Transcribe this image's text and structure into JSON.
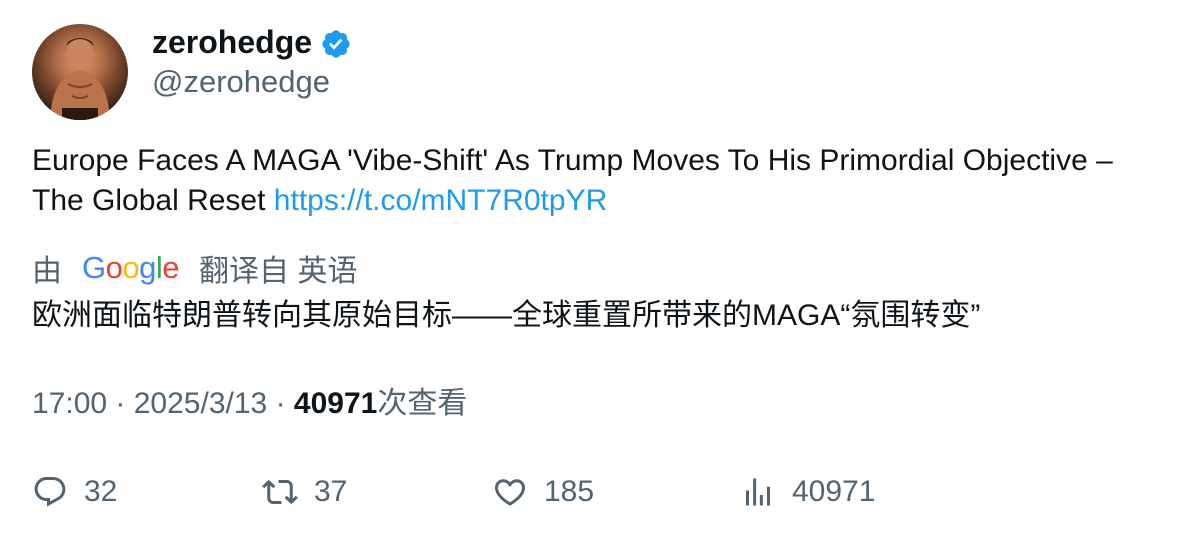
{
  "author": {
    "display_name": "zerohedge",
    "handle": "@zerohedge",
    "verified": true,
    "avatar_icon": "avatar-photo"
  },
  "tweet": {
    "text": "Europe Faces A MAGA 'Vibe-Shift' As Trump Moves To His Primordial Objective – The Global Reset ",
    "link": "https://t.co/mNT7R0tpYR"
  },
  "translation": {
    "prefix": "由",
    "provider_letters": [
      "G",
      "o",
      "o",
      "g",
      "l",
      "e"
    ],
    "suffix": "翻译自 英语",
    "text": "欧洲面临特朗普转向其原始目标——全球重置所带来的MAGA“氛围转变”"
  },
  "meta": {
    "time": "17:00",
    "separator": "·",
    "date": "2025/3/13",
    "views_count": "40971",
    "views_label": "次查看"
  },
  "actions": {
    "reply_count": "32",
    "retweet_count": "37",
    "like_count": "185",
    "views_count": "40971"
  },
  "colors": {
    "link": "#1d9bf0",
    "muted": "#536471",
    "text": "#0f1419",
    "verified": "#1d9bf0"
  }
}
